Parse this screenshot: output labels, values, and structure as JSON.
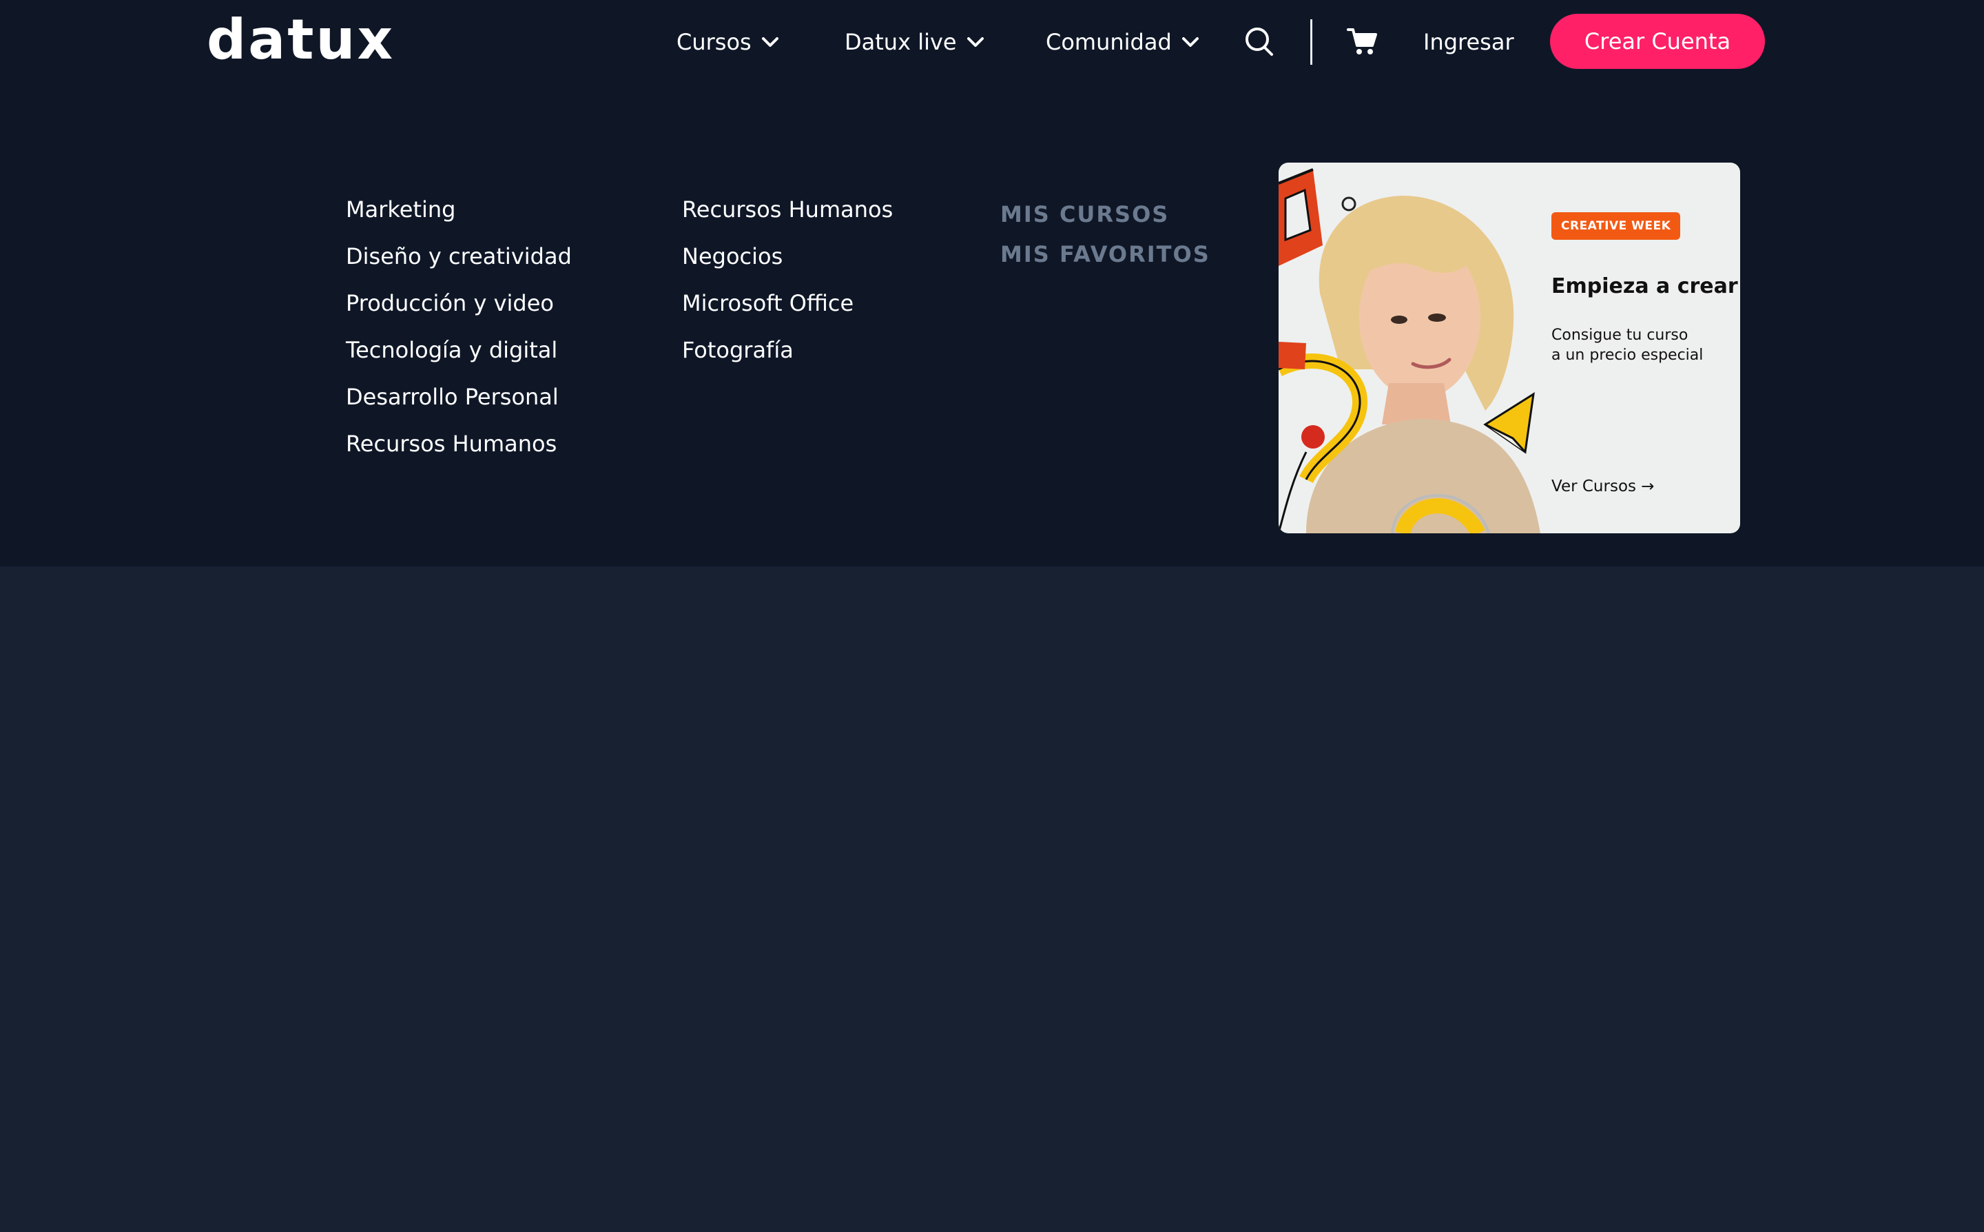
{
  "brand": {
    "logo_text": "datux"
  },
  "nav": {
    "items": [
      {
        "label": "Cursos",
        "has_dropdown": true
      },
      {
        "label": "Datux live",
        "has_dropdown": true
      },
      {
        "label": "Comunidad",
        "has_dropdown": true
      }
    ],
    "search_icon": "search-icon",
    "cart_icon": "cart-icon",
    "login_label": "Ingresar",
    "signup_label": "Crear Cuenta"
  },
  "mega_menu": {
    "categories_col1": [
      "Marketing",
      "Diseño y creatividad",
      "Producción y video",
      "Tecnología y digital",
      "Desarrollo Personal",
      "Recursos Humanos"
    ],
    "categories_col2": [
      "Recursos Humanos",
      "Negocios",
      "Microsoft Office",
      "Fotografía"
    ],
    "user_links": [
      "MIS CURSOS",
      "MIS FAVORITOS"
    ]
  },
  "promo": {
    "badge": "CREATIVE WEEK",
    "title": "Empieza a crear",
    "subtitle_line1": "Consigue tu curso",
    "subtitle_line2": "a un precio especial",
    "cta": "Ver Cursos →"
  },
  "colors": {
    "header_bg": "#0f1727",
    "page_bg": "#172132",
    "accent": "#ff2068",
    "muted_link": "#6b7a8f",
    "badge": "#f25a14",
    "card_bg": "#eef0ef"
  }
}
